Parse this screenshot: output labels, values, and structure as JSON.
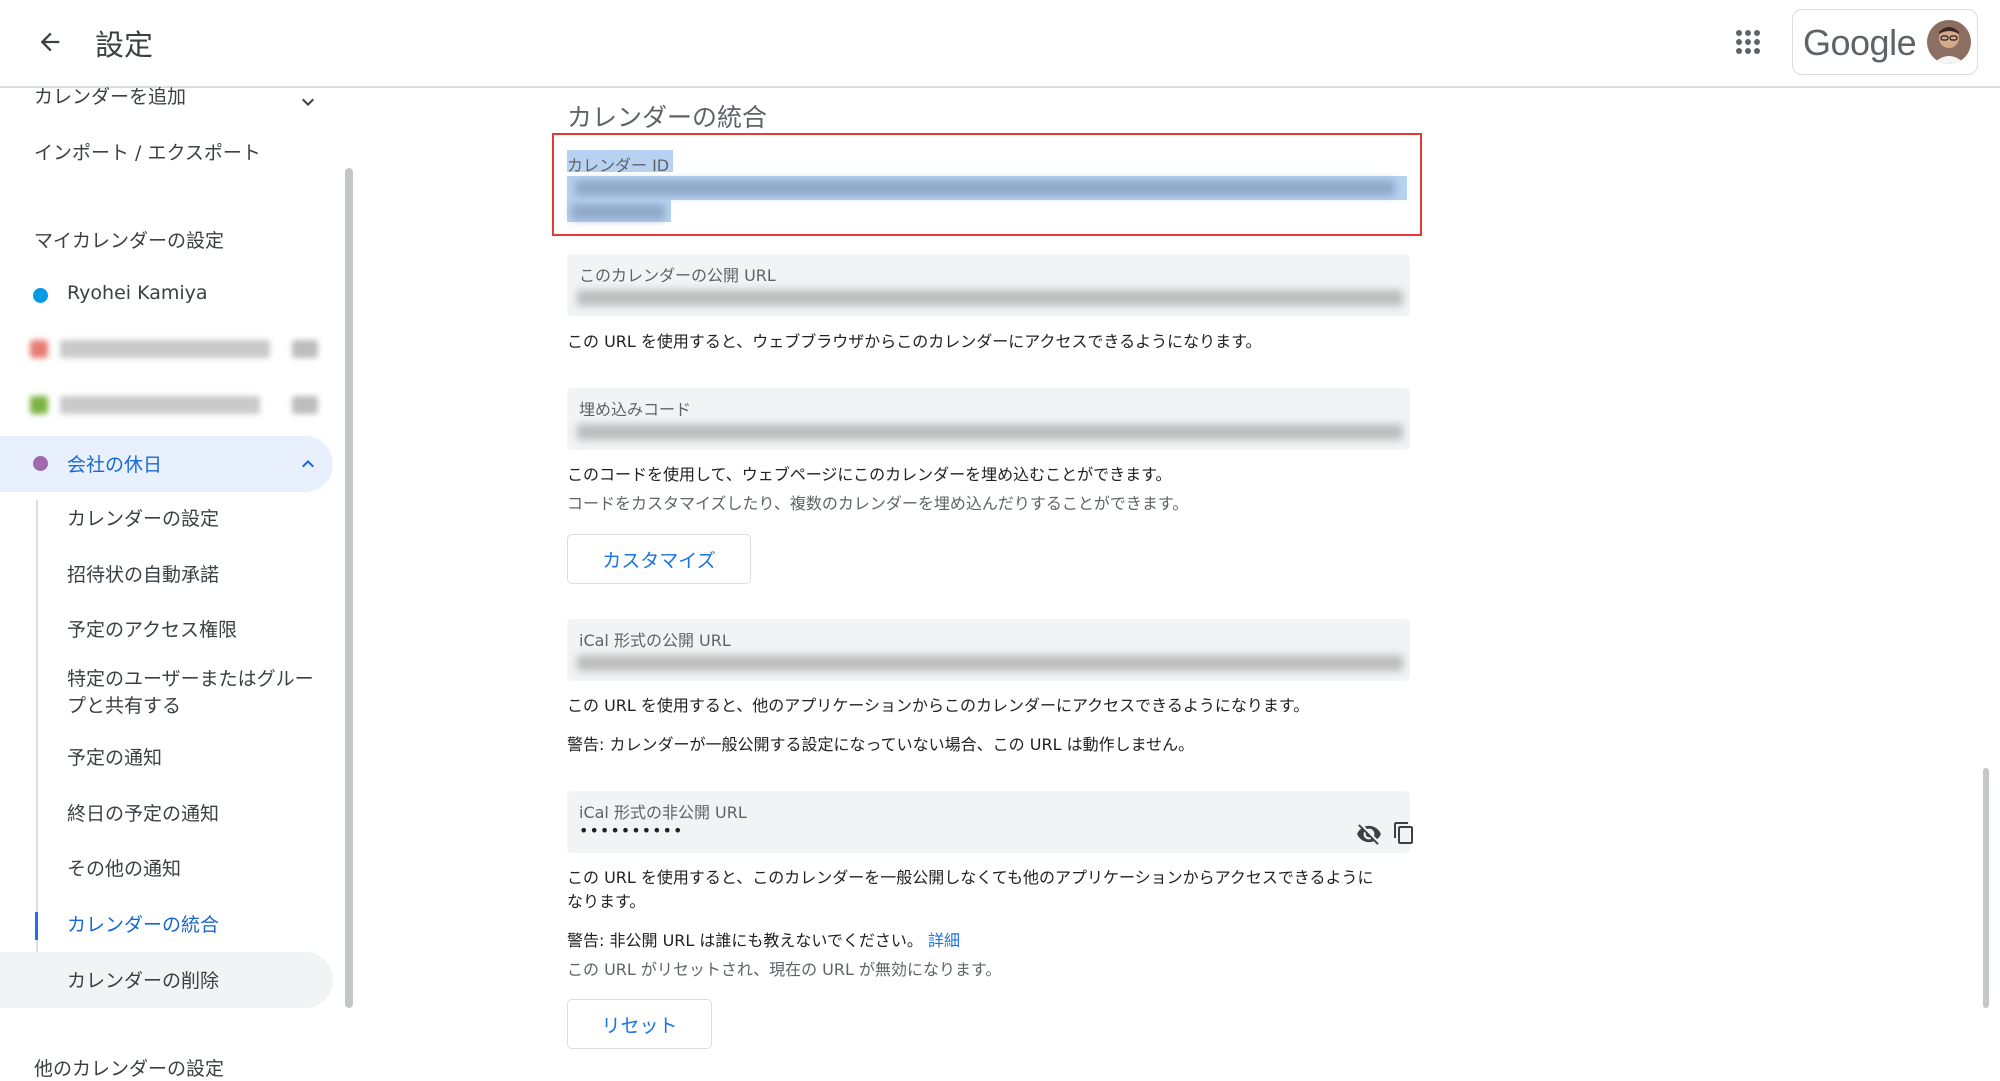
{
  "header": {
    "title": "設定",
    "google_logo": "Google",
    "back_icon": "arrow-back-icon",
    "apps_icon": "apps-grid-icon"
  },
  "sidebar": {
    "add_calendar": "カレンダーを追加",
    "import_export": "インポート / エクスポート",
    "my_calendars_heading": "マイカレンダーの設定",
    "calendars": [
      {
        "label": "Ryohei Kamiya",
        "color": "#039be5"
      },
      {
        "label": "",
        "color": "#e67c73"
      },
      {
        "label": "",
        "color": "#7cb342"
      },
      {
        "label": "会社の休日",
        "color": "#9e69af"
      }
    ],
    "sub_items": [
      "カレンダーの設定",
      "招待状の自動承諾",
      "予定のアクセス権限",
      "特定のユーザーまたはグループと共有する",
      "予定の通知",
      "終日の予定の通知",
      "その他の通知",
      "カレンダーの統合",
      "カレンダーの削除"
    ],
    "other_calendars_heading": "他のカレンダーの設定"
  },
  "main": {
    "section_title": "カレンダーの統合",
    "calendar_id_label": "カレンダー ID",
    "public_url": {
      "label": "このカレンダーの公開 URL",
      "note": "この URL を使用すると、ウェブブラウザからこのカレンダーにアクセスできるようになります。"
    },
    "embed": {
      "label": "埋め込みコード",
      "note": "このコードを使用して、ウェブページにこのカレンダーを埋め込むことができます。",
      "sub_note": "コードをカスタマイズしたり、複数のカレンダーを埋め込んだりすることができます。",
      "button": "カスタマイズ"
    },
    "ical_public": {
      "label": "iCal 形式の公開 URL",
      "note": "この URL を使用すると、他のアプリケーションからこのカレンダーにアクセスできるようになります。",
      "warning": "警告: カレンダーが一般公開する設定になっていない場合、この URL は動作しません。"
    },
    "ical_private": {
      "label": "iCal 形式の非公開 URL",
      "value": "••••••••••",
      "note_line1": "この URL を使用すると、このカレンダーを一般公開しなくても他のアプリケーションからアクセスできるように",
      "note_line2": "なります。",
      "warning": "警告: 非公開 URL は誰にも教えないでください。",
      "detail_link": "詳細",
      "reset_note": "この URL がリセットされ、現在の URL が無効になります。",
      "button": "リセット"
    }
  },
  "colors": {
    "accent": "#1a73e8",
    "selected_bg": "#e8f0fe",
    "highlight": "#e53935"
  }
}
